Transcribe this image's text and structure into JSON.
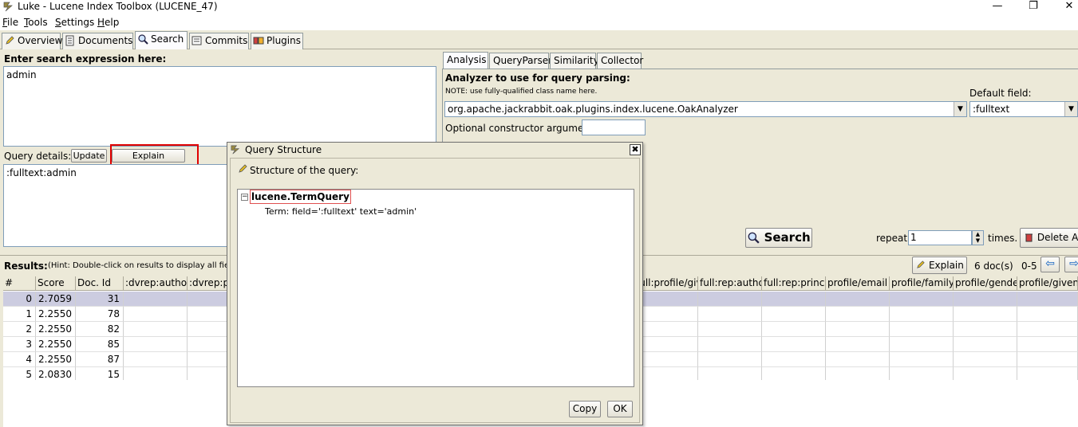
{
  "window": {
    "title": "Luke - Lucene Index Toolbox (LUCENE_47)",
    "minimize": "—",
    "maximize": "❐",
    "close": "✕"
  },
  "menu": {
    "items": [
      {
        "first": "F",
        "rest": "ile"
      },
      {
        "first": "T",
        "rest": "ools"
      },
      {
        "first": "S",
        "rest": "ettings"
      },
      {
        "first": "H",
        "rest": "elp"
      }
    ]
  },
  "main_tabs": [
    "Overview",
    "Documents",
    "Search",
    "Commits",
    "Plugins"
  ],
  "search": {
    "prompt": "Enter search expression here:",
    "expression": "admin",
    "query_details_label": "Query details:",
    "update_label": "Update",
    "explain_structure_label": "Explain structure",
    "query_details_value": ":fulltext:admin"
  },
  "right_tabs": [
    "Analysis",
    "QueryParser",
    "Similarity",
    "Collector"
  ],
  "analysis": {
    "heading": "Analyzer to use for query parsing:",
    "note": "NOTE: use fully-qualified class name here.",
    "analyzer": "org.apache.jackrabbit.oak.plugins.index.lucene.OakAnalyzer",
    "default_field_label": "Default field:",
    "default_field": ":fulltext",
    "optional_arg_label": "Optional constructor argument:",
    "optional_arg": ""
  },
  "controls": {
    "search_label": "Search",
    "repeat_label": "repeat",
    "repeat_value": "1",
    "times_label": "times.",
    "delete_label": "Delete All"
  },
  "results": {
    "label": "Results:",
    "hint": "(Hint: Double-click on results to display all fields)",
    "explain_label": "Explain",
    "doc_count": "6 doc(s)",
    "range": "0-5",
    "columns": [
      "#",
      "Score",
      "Doc. Id",
      ":dvrep:authoriz",
      ":dvrep:pr",
      "full:profile/give",
      "full:rep:authori",
      "full:rep:princip",
      "profile/email",
      "profile/familyN",
      "profile/gender",
      "profile/givenN"
    ],
    "rows": [
      {
        "n": "0",
        "score": "2.7059",
        "doc": "31"
      },
      {
        "n": "1",
        "score": "2.2550",
        "doc": "78"
      },
      {
        "n": "2",
        "score": "2.2550",
        "doc": "82"
      },
      {
        "n": "3",
        "score": "2.2550",
        "doc": "85"
      },
      {
        "n": "4",
        "score": "2.2550",
        "doc": "87"
      },
      {
        "n": "5",
        "score": "2.0830",
        "doc": "15"
      }
    ]
  },
  "dialog": {
    "title": "Query Structure",
    "subtitle": "Structure of the query:",
    "tree_root": "lucene.TermQuery",
    "tree_child": "Term: field=':fulltext' text='admin'",
    "copy_label": "Copy",
    "ok_label": "OK",
    "close_glyph": "✖"
  },
  "colors": {
    "accent_red": "#e00000",
    "selection": "#cccce0",
    "panel": "#ece9d8"
  }
}
